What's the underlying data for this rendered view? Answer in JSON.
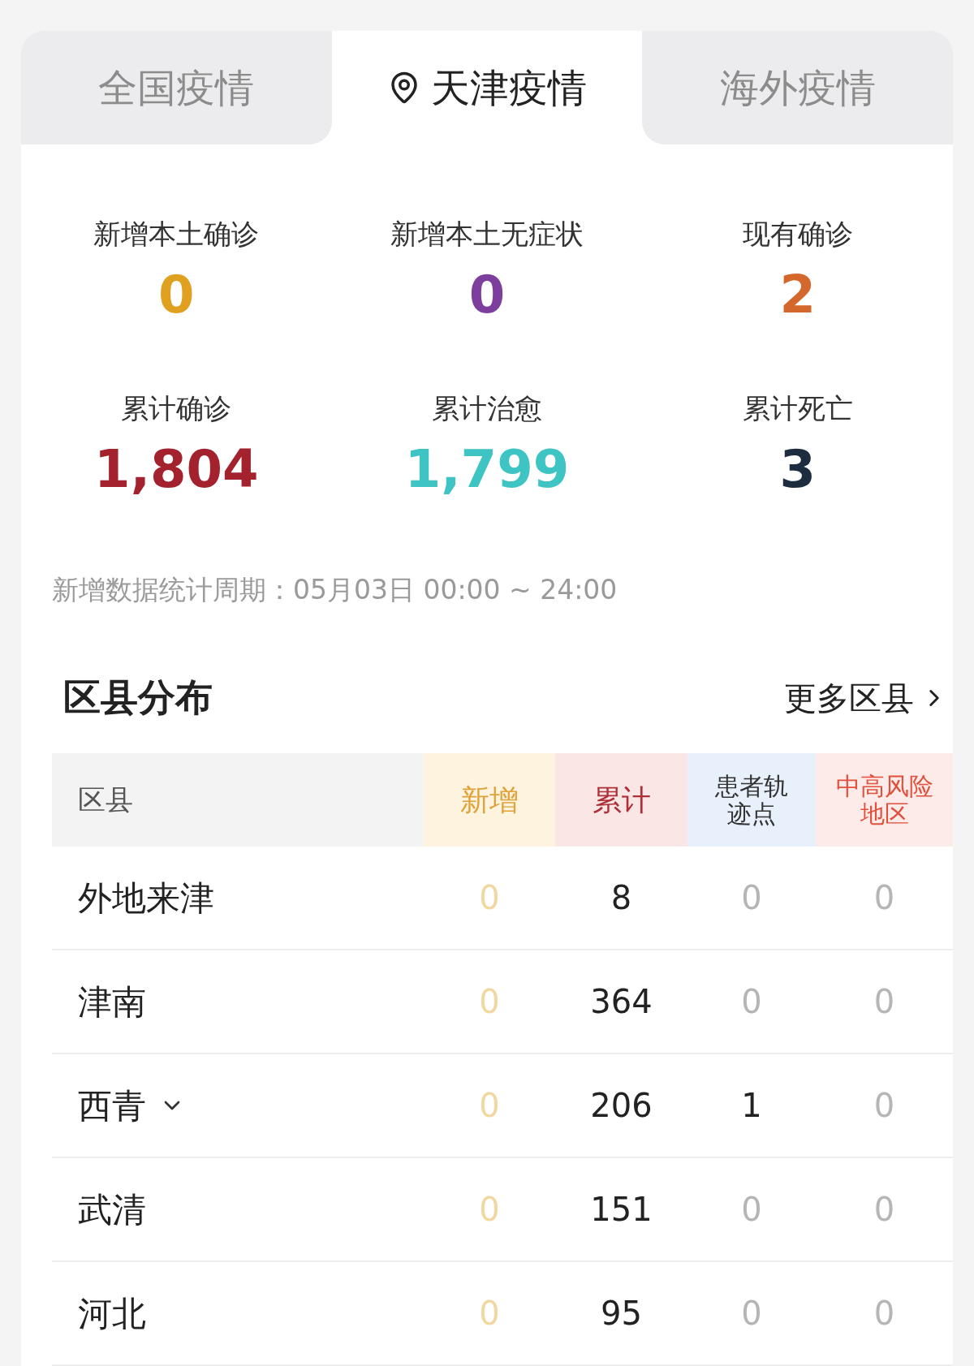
{
  "tabs": [
    {
      "label": "全国疫情",
      "selected": false
    },
    {
      "label": "天津疫情",
      "selected": true
    },
    {
      "label": "海外疫情",
      "selected": false
    }
  ],
  "stats": [
    {
      "label": "新增本土确诊",
      "value": "0",
      "color": "#e0a020"
    },
    {
      "label": "新增本土无症状",
      "value": "0",
      "color": "#7d3f9e"
    },
    {
      "label": "现有确诊",
      "value": "2",
      "color": "#d4672c"
    },
    {
      "label": "累计确诊",
      "value": "1,804",
      "color": "#a3222e"
    },
    {
      "label": "累计治愈",
      "value": "1,799",
      "color": "#3ec4c2"
    },
    {
      "label": "累计死亡",
      "value": "3",
      "color": "#1d2c3e"
    }
  ],
  "period": "新增数据统计周期：05月03日 00:00 ~ 24:00",
  "section": {
    "title": "区县分布",
    "more_link": "更多区县"
  },
  "table": {
    "columns": [
      {
        "label": "区县",
        "kind": "name"
      },
      {
        "label": "新增",
        "kind": "new"
      },
      {
        "label": "累计",
        "kind": "total"
      },
      {
        "label": "患者轨迹点",
        "kind": "track"
      },
      {
        "label": "中高风险地区",
        "kind": "risk"
      }
    ],
    "rows": [
      {
        "expandable": false,
        "cells": [
          {
            "value": "外地来津"
          },
          {
            "value": "0",
            "muted": true
          },
          {
            "value": "8",
            "muted": false
          },
          {
            "value": "0",
            "muted": true
          },
          {
            "value": "0",
            "muted": true
          }
        ]
      },
      {
        "expandable": false,
        "cells": [
          {
            "value": "津南"
          },
          {
            "value": "0",
            "muted": true
          },
          {
            "value": "364",
            "muted": false
          },
          {
            "value": "0",
            "muted": true
          },
          {
            "value": "0",
            "muted": true
          }
        ]
      },
      {
        "expandable": true,
        "cells": [
          {
            "value": "西青"
          },
          {
            "value": "0",
            "muted": true
          },
          {
            "value": "206",
            "muted": false
          },
          {
            "value": "1",
            "muted": false
          },
          {
            "value": "0",
            "muted": true
          }
        ]
      },
      {
        "expandable": false,
        "cells": [
          {
            "value": "武清"
          },
          {
            "value": "0",
            "muted": true
          },
          {
            "value": "151",
            "muted": false
          },
          {
            "value": "0",
            "muted": true
          },
          {
            "value": "0",
            "muted": true
          }
        ]
      },
      {
        "expandable": false,
        "cells": [
          {
            "value": "河北"
          },
          {
            "value": "0",
            "muted": true
          },
          {
            "value": "95",
            "muted": false
          },
          {
            "value": "0",
            "muted": true
          },
          {
            "value": "0",
            "muted": true
          }
        ]
      }
    ]
  }
}
